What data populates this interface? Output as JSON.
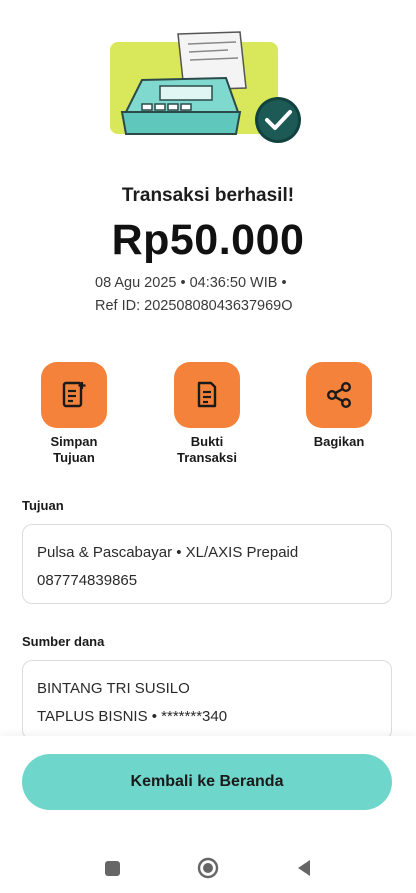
{
  "status": {
    "title": "Transaksi berhasil!",
    "amount": "Rp50.000",
    "datetime_line": "08 Agu 2025 • 04:36:50 WIB •",
    "ref_line": "Ref ID: 20250808043637969O"
  },
  "actions": [
    {
      "label_line1": "Simpan",
      "label_line2": "Tujuan",
      "icon": "save-note-icon"
    },
    {
      "label_line1": "Bukti",
      "label_line2": "Transaksi",
      "icon": "receipt-icon"
    },
    {
      "label_line1": "Bagikan",
      "label_line2": "",
      "icon": "share-icon"
    }
  ],
  "tujuan": {
    "label": "Tujuan",
    "line1": "Pulsa & Pascabayar • XL/AXIS Prepaid",
    "line2": "087774839865"
  },
  "sumber_dana": {
    "label": "Sumber dana",
    "line1": "BINTANG TRI SUSILO",
    "line2": "TAPLUS BISNIS • *******340"
  },
  "footer": {
    "home_button_label": "Kembali ke Beranda"
  },
  "colors": {
    "accent_orange": "#f5823a",
    "accent_teal": "#6fd6cb",
    "success_dark": "#11423f",
    "illustration_lime": "#d9e85a"
  },
  "system_nav": [
    "recent-apps-icon",
    "home-icon",
    "back-icon"
  ]
}
